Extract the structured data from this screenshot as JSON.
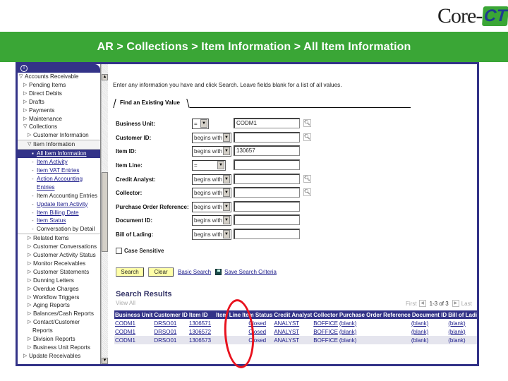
{
  "logo": {
    "text_core": "Core-",
    "text_ct": "CT"
  },
  "banner": {
    "breadcrumb": "AR > Collections > Item Information > All Item Information",
    "color": "#3aa636"
  },
  "frame_color": "#333388",
  "nav": {
    "header_icon": "portal-menu-icon",
    "items": [
      {
        "label": "Accounts Receivable",
        "level": 0,
        "icon": "expanded"
      },
      {
        "label": "Pending Items",
        "level": 1,
        "icon": "collapsed"
      },
      {
        "label": "Direct Debits",
        "level": 1,
        "icon": "collapsed"
      },
      {
        "label": "Drafts",
        "level": 1,
        "icon": "collapsed"
      },
      {
        "label": "Payments",
        "level": 1,
        "icon": "collapsed"
      },
      {
        "label": "Maintenance",
        "level": 1,
        "icon": "collapsed"
      },
      {
        "label": "Collections",
        "level": 1,
        "icon": "expanded"
      },
      {
        "label": "Customer Information",
        "level": 2,
        "icon": "collapsed"
      },
      {
        "label": "Item Information",
        "level": 2,
        "icon": "expanded"
      },
      {
        "label": "All Item Information",
        "level": 3,
        "icon": "bullet",
        "selected": true
      },
      {
        "label": "Item Activity",
        "level": 3,
        "icon": "bullet",
        "link": true
      },
      {
        "label": "Item VAT Entries",
        "level": 3,
        "icon": "bullet",
        "link": true
      },
      {
        "label": "Action Accounting",
        "level": 3,
        "icon": "bullet",
        "link": true
      },
      {
        "label": "Entries",
        "level": 3,
        "icon": "none",
        "link": true
      },
      {
        "label": "Item Accounting Entries",
        "level": 3,
        "icon": "bullet"
      },
      {
        "label": "Update Item Activity",
        "level": 3,
        "icon": "bullet",
        "link": true
      },
      {
        "label": "Item Billing Date",
        "level": 3,
        "icon": "bullet",
        "link": true
      },
      {
        "label": "Item Status",
        "level": 3,
        "icon": "bullet",
        "link": true
      },
      {
        "label": "Conversation by Detail",
        "level": 3,
        "icon": "bullet"
      },
      {
        "label": "Related Items",
        "level": 2,
        "icon": "collapsed"
      },
      {
        "label": "Customer Conversations",
        "level": 2,
        "icon": "collapsed"
      },
      {
        "label": "Customer Activity Status",
        "level": 2,
        "icon": "collapsed"
      },
      {
        "label": "Monitor Receivables",
        "level": 2,
        "icon": "collapsed"
      },
      {
        "label": "Customer Statements",
        "level": 2,
        "icon": "collapsed"
      },
      {
        "label": "Dunning Letters",
        "level": 2,
        "icon": "collapsed"
      },
      {
        "label": "Overdue Charges",
        "level": 2,
        "icon": "collapsed"
      },
      {
        "label": "Workflow Triggers",
        "level": 2,
        "icon": "collapsed"
      },
      {
        "label": "Aging Reports",
        "level": 2,
        "icon": "collapsed"
      },
      {
        "label": "Balances/Cash Reports",
        "level": 2,
        "icon": "collapsed"
      },
      {
        "label": "Contact/Customer",
        "level": 2,
        "icon": "collapsed"
      },
      {
        "label": "Reports",
        "level": 2,
        "icon": "none"
      },
      {
        "label": "Division Reports",
        "level": 2,
        "icon": "collapsed"
      },
      {
        "label": "Business Unit Reports",
        "level": 2,
        "icon": "collapsed"
      },
      {
        "label": "Update Receivables",
        "level": 1,
        "icon": "collapsed"
      }
    ]
  },
  "main": {
    "instructions": "Enter any information you have and click Search. Leave fields blank for a list of all values.",
    "find_tab": "Find an Existing Value",
    "fields": [
      {
        "label": "Business Unit:",
        "operator": "=",
        "value": "CODM1",
        "lookup": true
      },
      {
        "label": "Customer ID:",
        "operator": "begins with",
        "value": "",
        "lookup": true
      },
      {
        "label": "Item ID:",
        "operator": "begins with",
        "value": "130657",
        "lookup": false
      },
      {
        "label": "Item Line:",
        "operator": "=",
        "value": "",
        "lookup": false
      },
      {
        "label": "Credit Analyst:",
        "operator": "begins with",
        "value": "",
        "lookup": true
      },
      {
        "label": "Collector:",
        "operator": "begins with",
        "value": "",
        "lookup": true
      },
      {
        "label": "Purchase Order Reference:",
        "operator": "begins with",
        "value": "",
        "lookup": false
      },
      {
        "label": "Document ID:",
        "operator": "begins with",
        "value": "",
        "lookup": false
      },
      {
        "label": "Bill of Lading:",
        "operator": "begins with",
        "value": "",
        "lookup": false
      }
    ],
    "case_sensitive_label": "Case Sensitive",
    "case_sensitive_checked": false,
    "search_button": "Search",
    "clear_button": "Clear",
    "basic_search_link": "Basic Search",
    "save_criteria_link": "Save Search Criteria",
    "results": {
      "title": "Search Results",
      "view_all": "View All",
      "pager": {
        "first": "First",
        "count": "1-3 of 3",
        "last": "Last"
      },
      "columns": [
        "Business Unit",
        "Customer ID",
        "Item ID",
        "Item Line",
        "Item Status",
        "Credit Analyst",
        "Collector",
        "Purchase Order Reference",
        "Document ID",
        "Bill of Lading"
      ],
      "rows": [
        [
          "CODM1",
          "DRSO01",
          "1306571",
          "",
          "Closed",
          "ANALYST",
          "BOFFICE",
          "(blank)",
          "(blank)",
          "(blank)"
        ],
        [
          "CODM1",
          "DRSO01",
          "1306572",
          "",
          "Closed",
          "ANALYST",
          "BOFFICE",
          "(blank)",
          "(blank)",
          "(blank)"
        ],
        [
          "CODM1",
          "DRSO01",
          "1306573",
          "",
          "Closed",
          "ANALYST",
          "BOFFICE",
          "(blank)",
          "(blank)",
          "(blank)"
        ]
      ]
    }
  },
  "annotation": {
    "highlight": "Item Status column",
    "color": "#e8121e"
  }
}
